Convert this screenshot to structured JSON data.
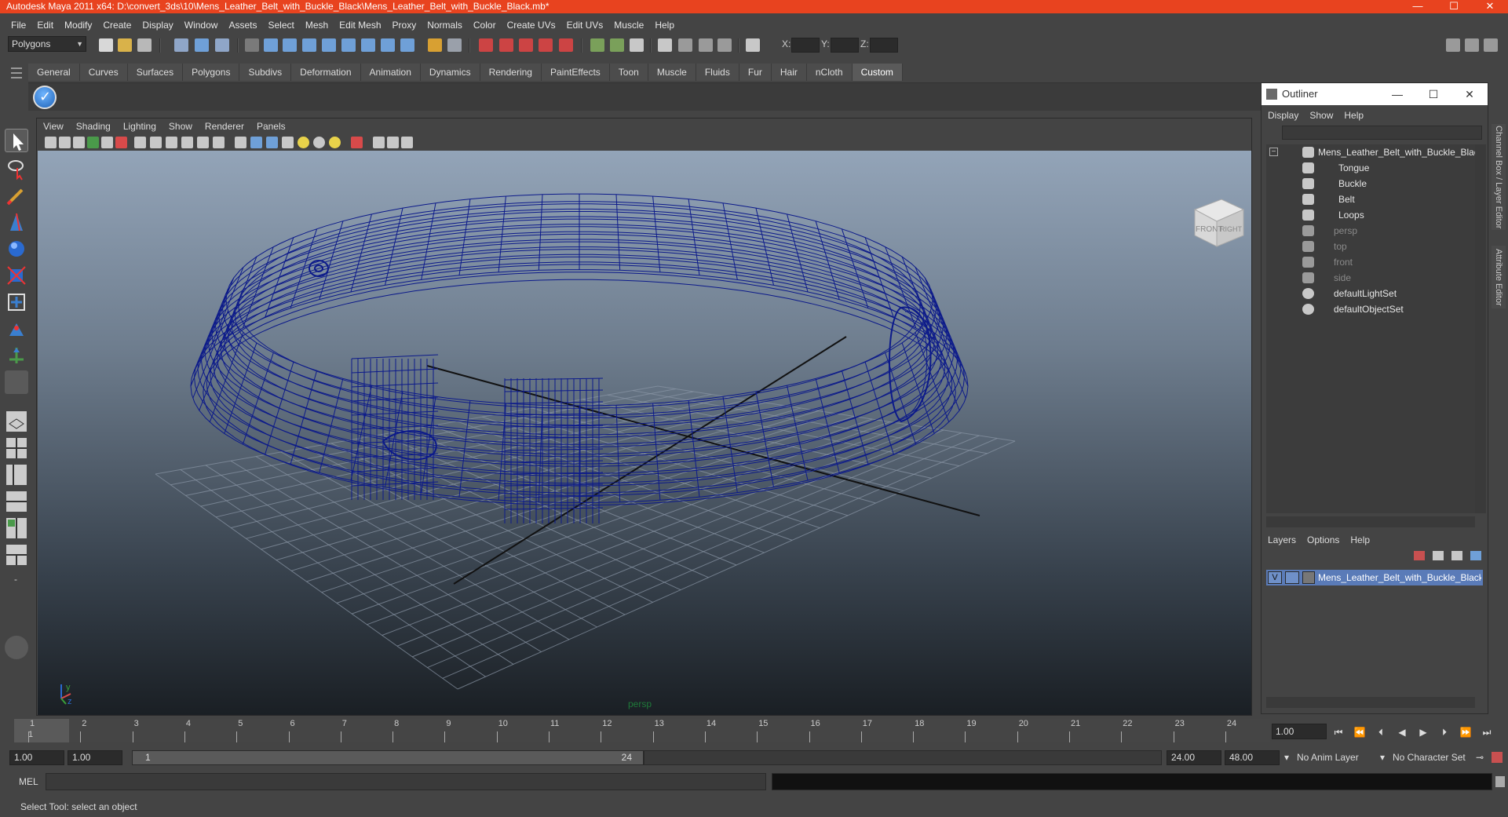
{
  "window": {
    "title": "Autodesk Maya 2011 x64: D:\\convert_3ds\\10\\Mens_Leather_Belt_with_Buckle_Black\\Mens_Leather_Belt_with_Buckle_Black.mb*",
    "minimize": "—",
    "maximize": "☐",
    "close": "✕"
  },
  "menubar": [
    "File",
    "Edit",
    "Modify",
    "Create",
    "Display",
    "Window",
    "Assets",
    "Select",
    "Mesh",
    "Edit Mesh",
    "Proxy",
    "Normals",
    "Color",
    "Create UVs",
    "Edit UVs",
    "Muscle",
    "Help"
  ],
  "statusline": {
    "mode": "Polygons",
    "x_label": "X:",
    "y_label": "Y:",
    "z_label": "Z:"
  },
  "shelf_tabs": [
    "General",
    "Curves",
    "Surfaces",
    "Polygons",
    "Subdivs",
    "Deformation",
    "Animation",
    "Dynamics",
    "Rendering",
    "PaintEffects",
    "Toon",
    "Muscle",
    "Fluids",
    "Fur",
    "Hair",
    "nCloth",
    "Custom"
  ],
  "shelf_active_tab": "Custom",
  "panel_menu": [
    "View",
    "Shading",
    "Lighting",
    "Show",
    "Renderer",
    "Panels"
  ],
  "viewport": {
    "camera_label": "persp",
    "viewcube_front": "FRONT",
    "viewcube_right": "RIGHT",
    "wire_color": "#0c1a8a"
  },
  "outliner": {
    "title": "Outliner",
    "menu": [
      "Display",
      "Show",
      "Help"
    ],
    "items": [
      {
        "label": "Mens_Leather_Belt_with_Buckle_Black",
        "dim": false,
        "icon": "group-transform-icon"
      },
      {
        "label": "Tongue",
        "dim": false,
        "icon": "mesh-transform-icon"
      },
      {
        "label": "Buckle",
        "dim": false,
        "icon": "mesh-transform-icon"
      },
      {
        "label": "Belt",
        "dim": false,
        "icon": "mesh-transform-icon"
      },
      {
        "label": "Loops",
        "dim": false,
        "icon": "mesh-transform-icon"
      },
      {
        "label": "persp",
        "dim": true,
        "icon": "camera-icon"
      },
      {
        "label": "top",
        "dim": true,
        "icon": "camera-icon"
      },
      {
        "label": "front",
        "dim": true,
        "icon": "camera-icon"
      },
      {
        "label": "side",
        "dim": true,
        "icon": "camera-icon"
      },
      {
        "label": "defaultLightSet",
        "dim": false,
        "icon": "set-icon"
      },
      {
        "label": "defaultObjectSet",
        "dim": false,
        "icon": "set-icon"
      }
    ],
    "layers_menu": [
      "Layers",
      "Options",
      "Help"
    ],
    "layer": {
      "visible_flag": "V",
      "name": "Mens_Leather_Belt_with_Buckle_Black_layer"
    }
  },
  "side_tabs": {
    "channel_box": "Channel Box / Layer Editor",
    "attribute_editor": "Attribute Editor"
  },
  "timeline": {
    "ticks": [
      "1",
      "2",
      "3",
      "4",
      "5",
      "6",
      "7",
      "8",
      "9",
      "10",
      "11",
      "12",
      "13",
      "14",
      "15",
      "16",
      "17",
      "18",
      "19",
      "20",
      "21",
      "22",
      "23",
      "24"
    ],
    "current_frame": "1",
    "current_frame_field": "1.00",
    "playback_buttons": [
      "⏮",
      "⏪",
      "⏴",
      "◀",
      "▶",
      "⏵",
      "⏩",
      "⏭"
    ]
  },
  "range": {
    "start": "1.00",
    "playback_start": "1.00",
    "slider_start": "1",
    "slider_end": "24",
    "playback_end": "24.00",
    "end": "48.00",
    "anim_layer": "No Anim Layer",
    "character_set": "No Character Set"
  },
  "command": {
    "label": "MEL"
  },
  "help_line": "Select Tool: select an object"
}
